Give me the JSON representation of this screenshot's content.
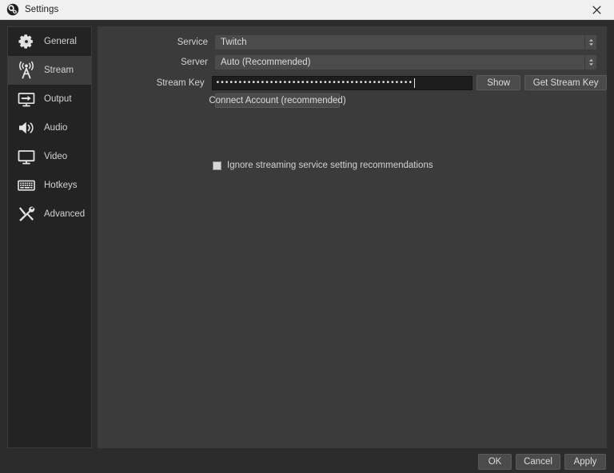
{
  "window": {
    "title": "Settings",
    "app_icon": "obs-logo-icon",
    "close_label": "close-icon"
  },
  "sidebar": {
    "selected": "Stream",
    "items": [
      {
        "label": "General",
        "icon": "gear-icon"
      },
      {
        "label": "Stream",
        "icon": "broadcast-antenna-icon"
      },
      {
        "label": "Output",
        "icon": "monitor-arrow-icon"
      },
      {
        "label": "Audio",
        "icon": "speaker-icon"
      },
      {
        "label": "Video",
        "icon": "monitor-icon"
      },
      {
        "label": "Hotkeys",
        "icon": "keyboard-icon"
      },
      {
        "label": "Advanced",
        "icon": "wrench-screwdriver-icon"
      }
    ]
  },
  "stream_settings": {
    "service": {
      "label": "Service",
      "value": "Twitch"
    },
    "server": {
      "label": "Server",
      "value": "Auto (Recommended)"
    },
    "stream_key": {
      "label": "Stream Key",
      "masked_value": "••••••••••••••••••••••••••••••••••••••••••••",
      "show_button": "Show",
      "get_key_button": "Get Stream Key"
    },
    "connect_account_button": "Connect Account (recommended)",
    "ignore_recommendations": {
      "label": "Ignore streaming service setting recommendations",
      "checked": false
    }
  },
  "footer": {
    "ok": "OK",
    "cancel": "Cancel",
    "apply": "Apply"
  },
  "colors": {
    "titlebar_bg": "#f0f0f0",
    "window_bg": "#2c2c2c",
    "sidebar_bg": "#232323",
    "sidebar_selected": "#3d3d3d",
    "content_bg": "#3b3b3b",
    "control_bg": "#4b4b4b",
    "field_bg": "#1d1d1d",
    "text": "#d2d2d2"
  }
}
